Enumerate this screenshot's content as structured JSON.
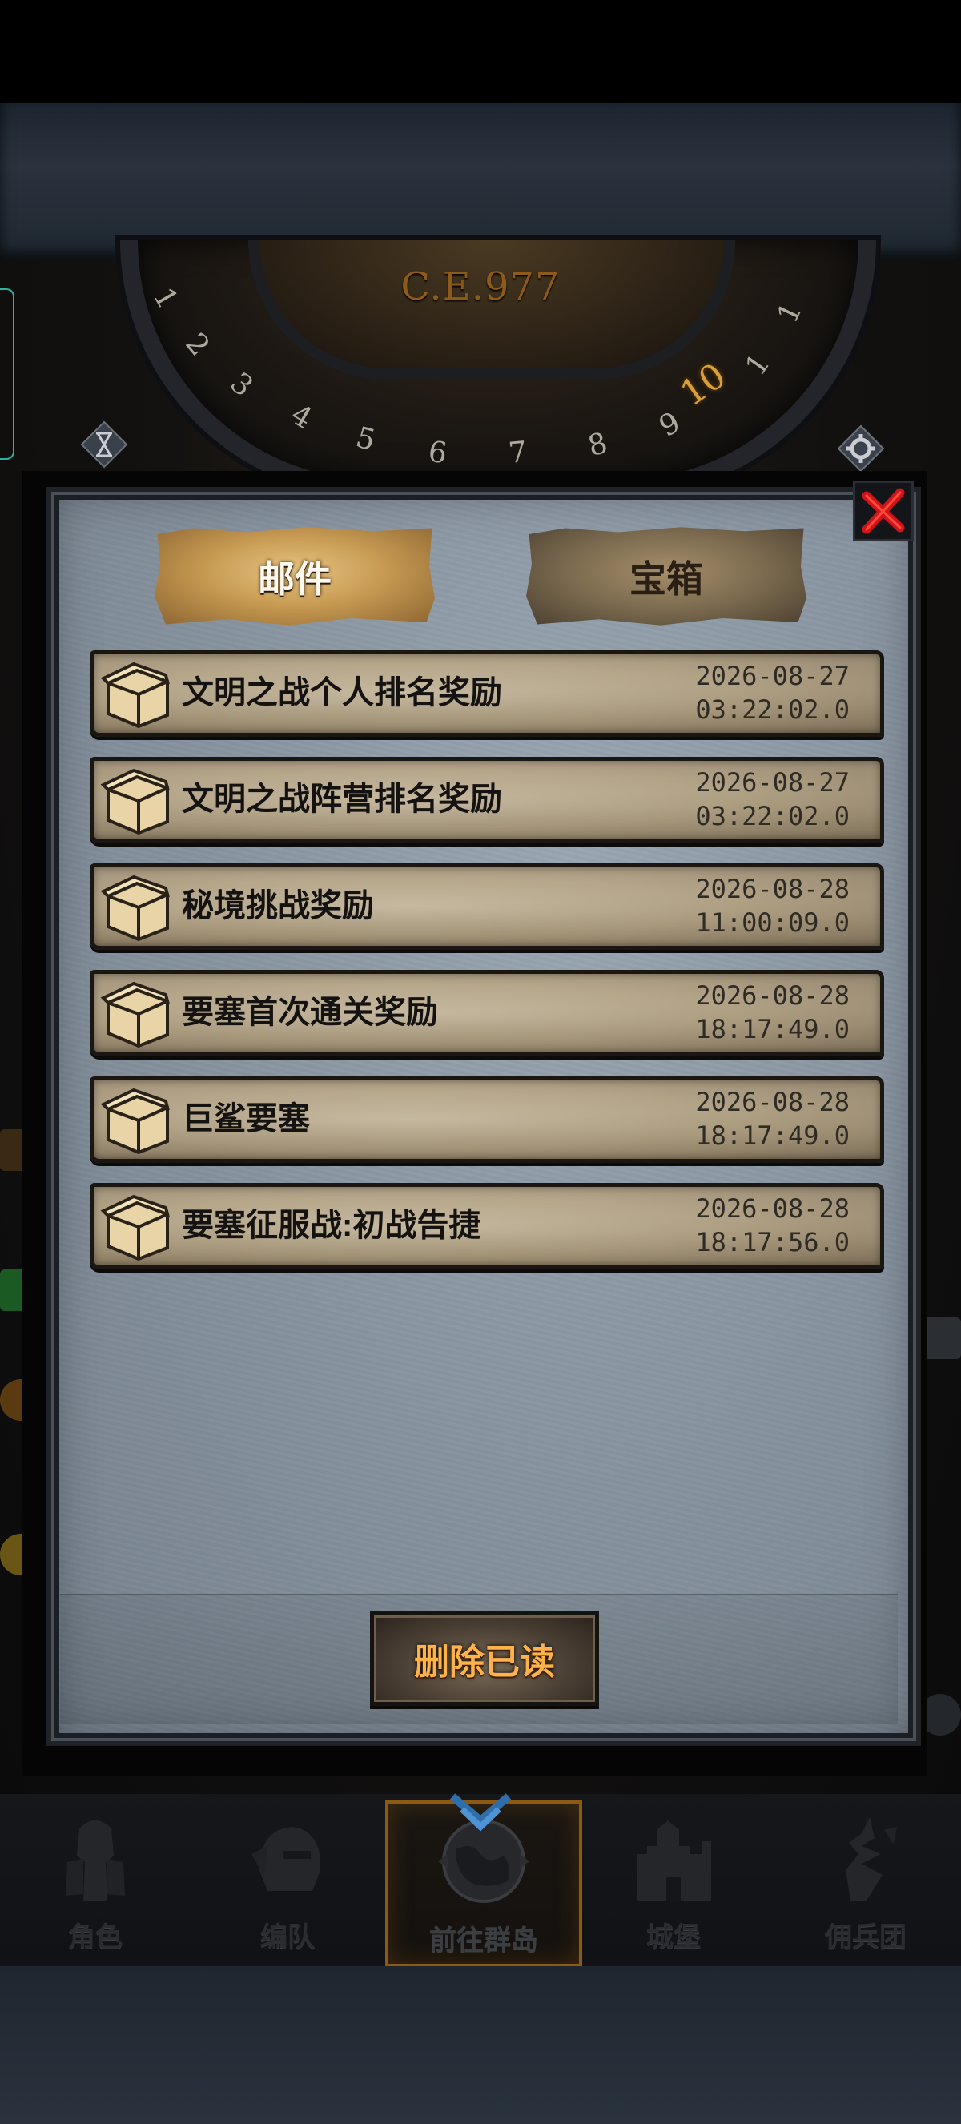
{
  "era_label": "C.E.977",
  "dial_day": "10",
  "tabs": {
    "mail": "邮件",
    "chest": "宝箱"
  },
  "mails": [
    {
      "title": "文明之战个人排名奖励",
      "date": "2026-08-27",
      "time": "03:22:02.0"
    },
    {
      "title": "文明之战阵营排名奖励",
      "date": "2026-08-27",
      "time": "03:22:02.0"
    },
    {
      "title": "秘境挑战奖励",
      "date": "2026-08-28",
      "time": "11:00:09.0"
    },
    {
      "title": "要塞首次通关奖励",
      "date": "2026-08-28",
      "time": "18:17:49.0"
    },
    {
      "title": "巨鲨要塞",
      "date": "2026-08-28",
      "time": "18:17:49.0"
    },
    {
      "title": "要塞征服战:初战告捷",
      "date": "2026-08-28",
      "time": "18:17:56.0"
    }
  ],
  "delete_read_label": "删除已读",
  "nav": [
    {
      "label": "角色",
      "icon": "knight-icon"
    },
    {
      "label": "编队",
      "icon": "helmet-icon"
    },
    {
      "label": "前往群岛",
      "icon": "globe-icon",
      "active": true
    },
    {
      "label": "城堡",
      "icon": "castle-icon"
    },
    {
      "label": "佣兵团",
      "icon": "mercenary-icon"
    }
  ],
  "colors": {
    "active_tab": "#c79a52",
    "delete_text": "#ffb24a",
    "close_x": "#d0141a",
    "era_text": "#8d5a1a"
  }
}
